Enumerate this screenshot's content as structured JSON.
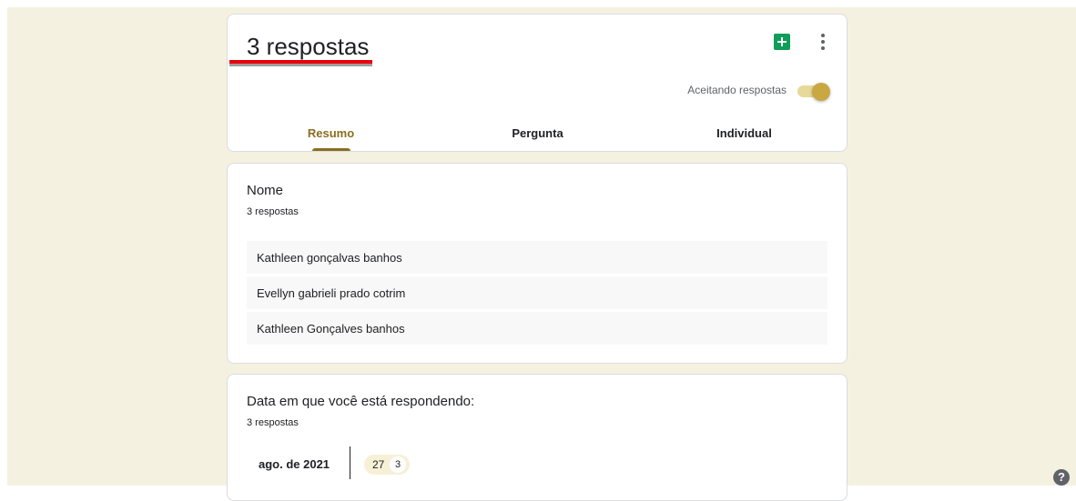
{
  "header": {
    "title": "3 respostas",
    "accepting_label": "Aceitando respostas",
    "accepting_on": true,
    "icons": {
      "sheets": "google-sheets-icon",
      "more": "more-vert-icon"
    },
    "tabs": [
      {
        "label": "Resumo",
        "active": true
      },
      {
        "label": "Pergunta",
        "active": false
      },
      {
        "label": "Individual",
        "active": false
      }
    ]
  },
  "questions": {
    "nome": {
      "title": "Nome",
      "count": "3 respostas",
      "answers": [
        "Kathleen gonçalvas banhos",
        "Evellyn gabrieli prado cotrim",
        "Kathleen Gonçalves banhos"
      ]
    },
    "data": {
      "title": "Data em que você está respondendo:",
      "count": "3 respostas",
      "month_label": "ago. de 2021",
      "day": "27",
      "day_count": "3"
    }
  },
  "help": {
    "icon": "help-icon",
    "glyph": "?"
  },
  "colors": {
    "background": "#f5f1e1",
    "accent": "#8a6d1f",
    "toggle": "#c9a842",
    "sheets": "#0f9d58"
  }
}
